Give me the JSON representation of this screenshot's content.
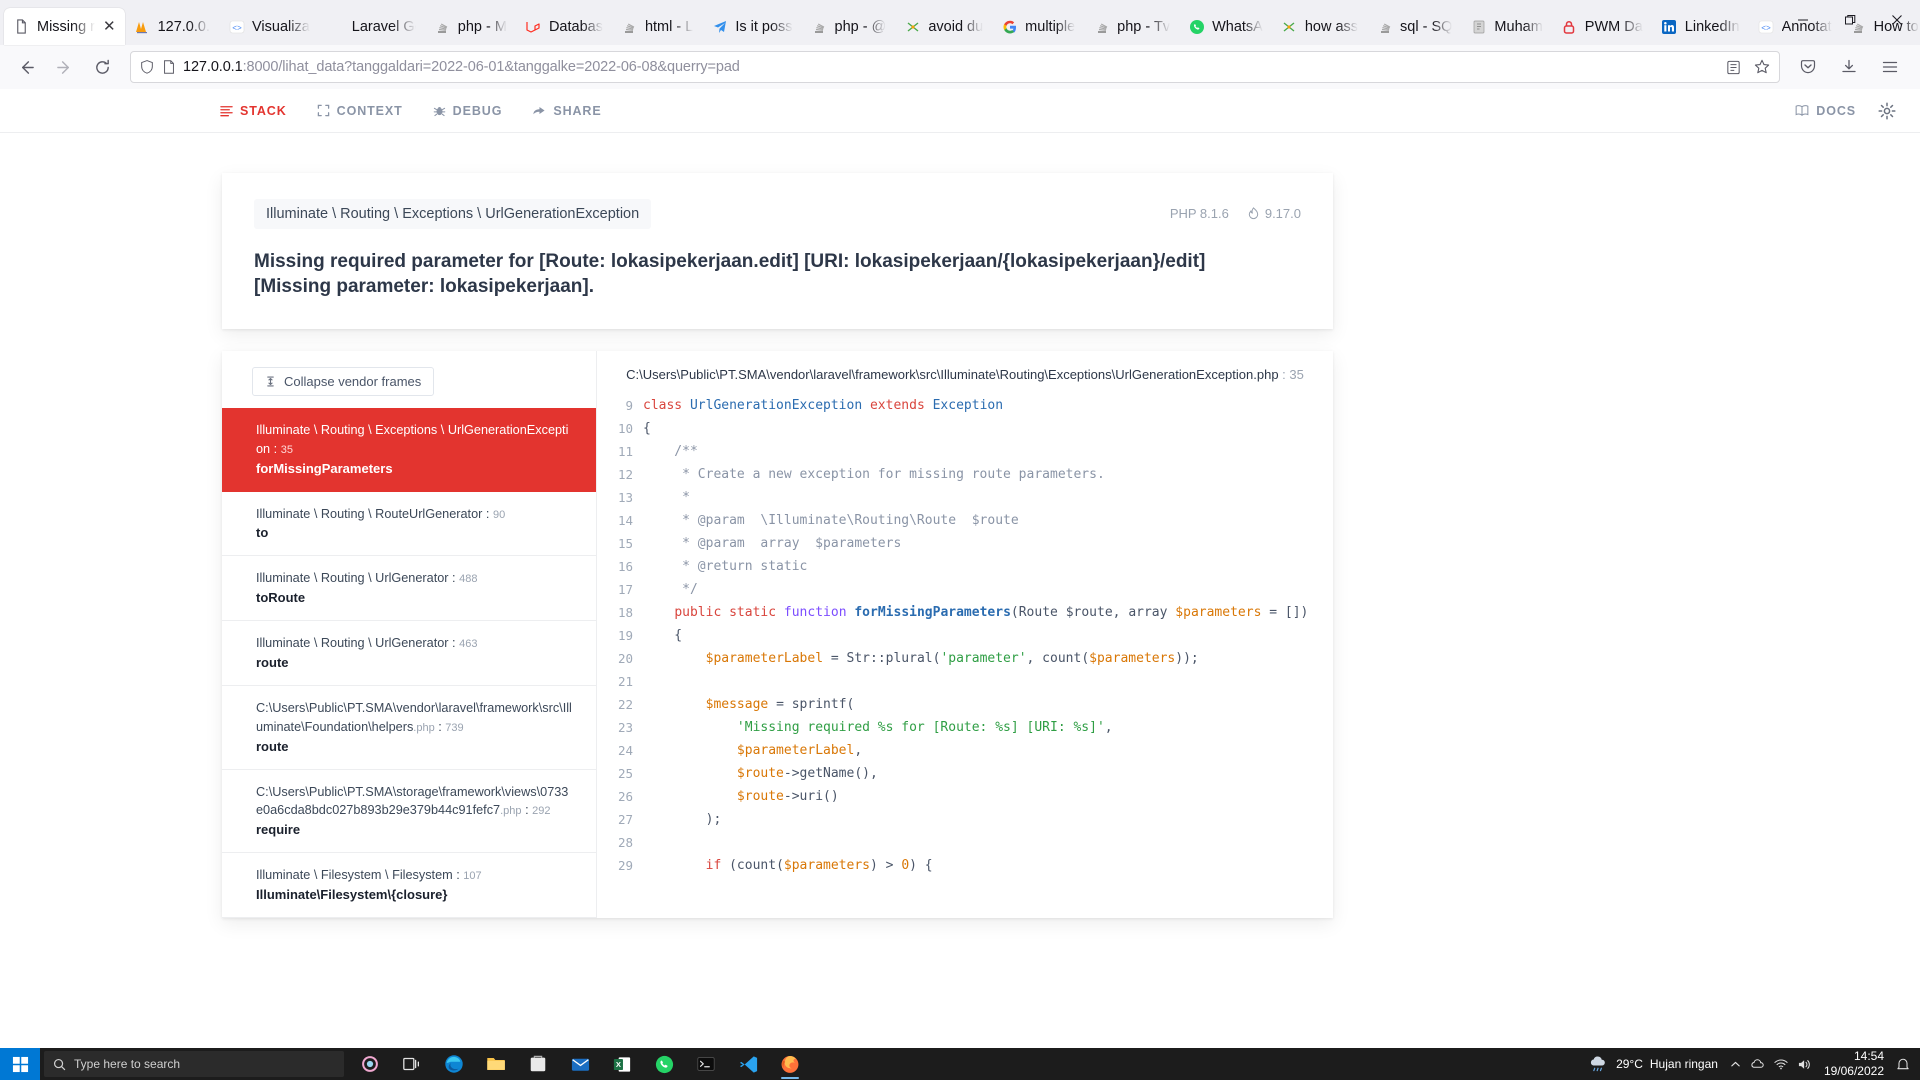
{
  "browser": {
    "tabs": [
      {
        "label": "Missing re",
        "icon": "doc-icon",
        "active": true
      },
      {
        "label": "127.0.0.",
        "icon": "phpmyadmin-icon",
        "active": false
      },
      {
        "label": "Visualiza",
        "icon": "annotate-icon",
        "active": false
      },
      {
        "label": "Laravel Goo",
        "icon": "blank-icon",
        "active": false
      },
      {
        "label": "php - M",
        "icon": "stackoverflow-icon",
        "active": false
      },
      {
        "label": "Databas",
        "icon": "laravel-icon",
        "active": false
      },
      {
        "label": "html - L",
        "icon": "stackoverflow-icon",
        "active": false
      },
      {
        "label": "Is it poss",
        "icon": "telegram-icon",
        "active": false
      },
      {
        "label": "php - @",
        "icon": "stackoverflow-icon",
        "active": false
      },
      {
        "label": "avoid du",
        "icon": "stackexchange-icon",
        "active": false
      },
      {
        "label": "multiple",
        "icon": "google-icon",
        "active": false
      },
      {
        "label": "php - Tv",
        "icon": "stackoverflow-icon",
        "active": false
      },
      {
        "label": "WhatsA",
        "icon": "whatsapp-icon",
        "active": false
      },
      {
        "label": "how ass",
        "icon": "stackexchange-icon",
        "active": false
      },
      {
        "label": "sql - SQ",
        "icon": "stackoverflow-icon",
        "active": false
      },
      {
        "label": "Muham",
        "icon": "file-icon",
        "active": false
      },
      {
        "label": "PWM Da",
        "icon": "lock-icon",
        "active": false
      },
      {
        "label": "LinkedIn",
        "icon": "linkedin-icon",
        "active": false
      },
      {
        "label": "Annotat",
        "icon": "annotate-icon",
        "active": false
      },
      {
        "label": "How to",
        "icon": "stackoverflow-icon",
        "active": false
      }
    ],
    "new_tab_label": "+",
    "window_controls": {
      "minimize": "minimize-icon",
      "maximize": "maximize-icon",
      "close": "close-icon"
    },
    "nav": {
      "back": "back-arrow-icon",
      "forward": "forward-arrow-icon",
      "reload": "reload-icon",
      "shield": "shield-icon",
      "page": "page-icon",
      "reader": "reader-view-icon",
      "bookmark": "star-icon",
      "pocket": "pocket-icon",
      "downloads": "download-icon",
      "menu": "hamburger-menu-icon"
    },
    "url": {
      "host": "127.0.0.1",
      "rest": ":8000/lihat_data?tanggaldari=2022-06-01&tanggalke=2022-06-08&querry=pad"
    }
  },
  "ignition": {
    "tabs": [
      {
        "label": "STACK",
        "icon": "stack-icon",
        "active": true
      },
      {
        "label": "CONTEXT",
        "icon": "context-icon",
        "active": false
      },
      {
        "label": "DEBUG",
        "icon": "bug-icon",
        "active": false
      },
      {
        "label": "SHARE",
        "icon": "share-icon",
        "active": false
      }
    ],
    "docs_label": "DOCS",
    "docs_icon": "book-icon",
    "settings_icon": "gear-icon",
    "exception_class": "Illuminate \\ Routing \\ Exceptions \\ UrlGenerationException",
    "php_version": "PHP 8.1.6",
    "ignition_version": "9.17.0",
    "message": "Missing required parameter for [Route: lokasipekerjaan.edit] [URI: lokasipekerjaan/{lokasipekerjaan}/edit] [Missing parameter: lokasipekerjaan].",
    "collapse_label": "Collapse vendor frames",
    "collapse_icon": "collapse-icon",
    "frames": [
      {
        "cls": "Illuminate \\ Routing \\ Exceptions \\ UrlGenerationException",
        "line": "35",
        "fn": "forMissingParameters",
        "active": true
      },
      {
        "cls": "Illuminate \\ Routing \\ RouteUrlGenerator",
        "line": "90",
        "fn": "to",
        "active": false
      },
      {
        "cls": "Illuminate \\ Routing \\ UrlGenerator",
        "line": "488",
        "fn": "toRoute",
        "active": false
      },
      {
        "cls": "Illuminate \\ Routing \\ UrlGenerator",
        "line": "463",
        "fn": "route",
        "active": false
      },
      {
        "cls": "C:\\Users\\Public\\PT.SMA\\vendor\\laravel\\framework\\src\\Illuminate\\Foundation\\helpers",
        "suffix": ".php",
        "line": "739",
        "fn": "route",
        "active": false
      },
      {
        "cls": "C:\\Users\\Public\\PT.SMA\\storage\\framework\\views\\0733e0a6cda8bdc027b893b29e379b44c91fefc7",
        "suffix": ".php",
        "line": "292",
        "fn": "require",
        "active": false
      },
      {
        "cls": "Illuminate \\ Filesystem \\ Filesystem",
        "line": "107",
        "fn": "Illuminate\\Filesystem\\{closure}",
        "active": false
      }
    ],
    "code_path": "C:\\Users\\Public\\PT.SMA\\vendor\\laravel\\framework\\src\\Illuminate\\Routing\\Exceptions\\UrlGenerationException.php",
    "code_path_line": "35",
    "code": [
      {
        "n": "9",
        "tokens": [
          {
            "t": "class ",
            "c": "k"
          },
          {
            "t": "UrlGenerationException ",
            "c": "cls"
          },
          {
            "t": "extends ",
            "c": "k"
          },
          {
            "t": "Exception",
            "c": "cls"
          }
        ]
      },
      {
        "n": "10",
        "tokens": [
          {
            "t": "{",
            "c": "op"
          }
        ]
      },
      {
        "n": "11",
        "tokens": [
          {
            "t": "    /**",
            "c": "cm"
          }
        ]
      },
      {
        "n": "12",
        "tokens": [
          {
            "t": "     * Create a new exception for missing route parameters.",
            "c": "cm"
          }
        ]
      },
      {
        "n": "13",
        "tokens": [
          {
            "t": "     *",
            "c": "cm"
          }
        ]
      },
      {
        "n": "14",
        "tokens": [
          {
            "t": "     * @param  \\Illuminate\\Routing\\Route  $route",
            "c": "cm"
          }
        ]
      },
      {
        "n": "15",
        "tokens": [
          {
            "t": "     * @param  array  $parameters",
            "c": "cm"
          }
        ]
      },
      {
        "n": "16",
        "tokens": [
          {
            "t": "     * @return static",
            "c": "cm"
          }
        ]
      },
      {
        "n": "17",
        "tokens": [
          {
            "t": "     */",
            "c": "cm"
          }
        ]
      },
      {
        "n": "18",
        "tokens": [
          {
            "t": "    ",
            "c": "op"
          },
          {
            "t": "public ",
            "c": "k"
          },
          {
            "t": "static ",
            "c": "k"
          },
          {
            "t": "function ",
            "c": "kf"
          },
          {
            "t": "forMissingParameters",
            "c": "fn"
          },
          {
            "t": "(Route ",
            "c": "op"
          },
          {
            "t": "$route",
            "c": "op"
          },
          {
            "t": ", ",
            "c": "op"
          },
          {
            "t": "array ",
            "c": "op"
          },
          {
            "t": "$parameters",
            "c": "var"
          },
          {
            "t": " = [])",
            "c": "op"
          }
        ]
      },
      {
        "n": "19",
        "tokens": [
          {
            "t": "    {",
            "c": "op"
          }
        ]
      },
      {
        "n": "20",
        "tokens": [
          {
            "t": "        ",
            "c": "op"
          },
          {
            "t": "$parameterLabel",
            "c": "var"
          },
          {
            "t": " = Str::plural(",
            "c": "op"
          },
          {
            "t": "'parameter'",
            "c": "str"
          },
          {
            "t": ", count(",
            "c": "op"
          },
          {
            "t": "$parameters",
            "c": "var"
          },
          {
            "t": "));",
            "c": "op"
          }
        ]
      },
      {
        "n": "21",
        "tokens": [
          {
            "t": "",
            "c": "op"
          }
        ]
      },
      {
        "n": "22",
        "tokens": [
          {
            "t": "        ",
            "c": "op"
          },
          {
            "t": "$message",
            "c": "var"
          },
          {
            "t": " = sprintf(",
            "c": "op"
          }
        ]
      },
      {
        "n": "23",
        "tokens": [
          {
            "t": "            ",
            "c": "op"
          },
          {
            "t": "'Missing required %s for [Route: %s] [URI: %s]'",
            "c": "str"
          },
          {
            "t": ",",
            "c": "op"
          }
        ]
      },
      {
        "n": "24",
        "tokens": [
          {
            "t": "            ",
            "c": "op"
          },
          {
            "t": "$parameterLabel",
            "c": "var"
          },
          {
            "t": ",",
            "c": "op"
          }
        ]
      },
      {
        "n": "25",
        "tokens": [
          {
            "t": "            ",
            "c": "op"
          },
          {
            "t": "$route",
            "c": "var"
          },
          {
            "t": "->getName(),",
            "c": "op"
          }
        ]
      },
      {
        "n": "26",
        "tokens": [
          {
            "t": "            ",
            "c": "op"
          },
          {
            "t": "$route",
            "c": "var"
          },
          {
            "t": "->uri()",
            "c": "op"
          }
        ]
      },
      {
        "n": "27",
        "tokens": [
          {
            "t": "        );",
            "c": "op"
          }
        ]
      },
      {
        "n": "28",
        "tokens": [
          {
            "t": "",
            "c": "op"
          }
        ]
      },
      {
        "n": "29",
        "tokens": [
          {
            "t": "        ",
            "c": "op"
          },
          {
            "t": "if ",
            "c": "k"
          },
          {
            "t": "(count(",
            "c": "op"
          },
          {
            "t": "$parameters",
            "c": "var"
          },
          {
            "t": ") > ",
            "c": "op"
          },
          {
            "t": "0",
            "c": "num"
          },
          {
            "t": ") {",
            "c": "op"
          }
        ]
      }
    ]
  },
  "taskbar": {
    "start_icon": "windows-start-icon",
    "search_placeholder": "Type here to search",
    "search_icon": "search-icon",
    "apps": [
      {
        "name": "cortana-icon"
      },
      {
        "name": "task-view-icon"
      },
      {
        "name": "edge-icon"
      },
      {
        "name": "file-explorer-icon"
      },
      {
        "name": "store-icon"
      },
      {
        "name": "mail-icon"
      },
      {
        "name": "excel-icon"
      },
      {
        "name": "whatsapp-icon"
      },
      {
        "name": "terminal-icon"
      },
      {
        "name": "vscode-icon"
      },
      {
        "name": "firefox-icon"
      }
    ],
    "weather_temp": "29°C",
    "weather_desc": "Hujan ringan",
    "weather_icon": "rain-cloud-icon",
    "tray": [
      "chevron-up-icon",
      "cloud-icon",
      "network-icon",
      "volume-icon"
    ],
    "time": "14:54",
    "date": "19/06/2022",
    "notification_icon": "notification-icon"
  }
}
